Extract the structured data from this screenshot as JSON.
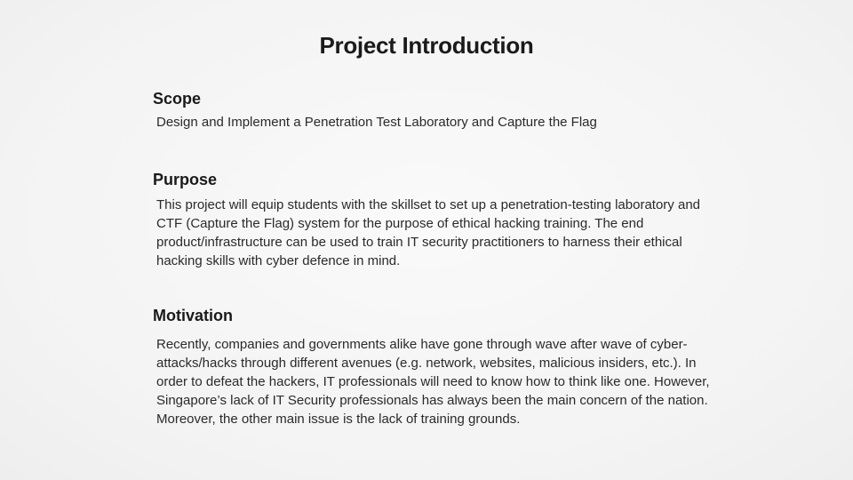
{
  "slide": {
    "title": "Project Introduction",
    "sections": [
      {
        "heading": "Scope",
        "text": "Design and Implement a Penetration Test Laboratory and Capture the Flag"
      },
      {
        "heading": "Purpose",
        "text": "This project will equip students with the skillset to set up a penetration-testing laboratory and CTF (Capture the Flag) system for the purpose of ethical hacking training. The end product/infrastructure can be used to train IT security practitioners to harness their ethical hacking skills with cyber defence in mind."
      },
      {
        "heading": "Motivation",
        "text": "Recently, companies and governments alike have gone through wave after wave of cyber-attacks/hacks through different avenues (e.g. network, websites, malicious insiders, etc.). In order to defeat the hackers, IT professionals will need to know how to think like one. However, Singapore’s lack of IT Security professionals has always been the main concern of the nation. Moreover, the other main issue is the lack of training grounds."
      }
    ]
  }
}
